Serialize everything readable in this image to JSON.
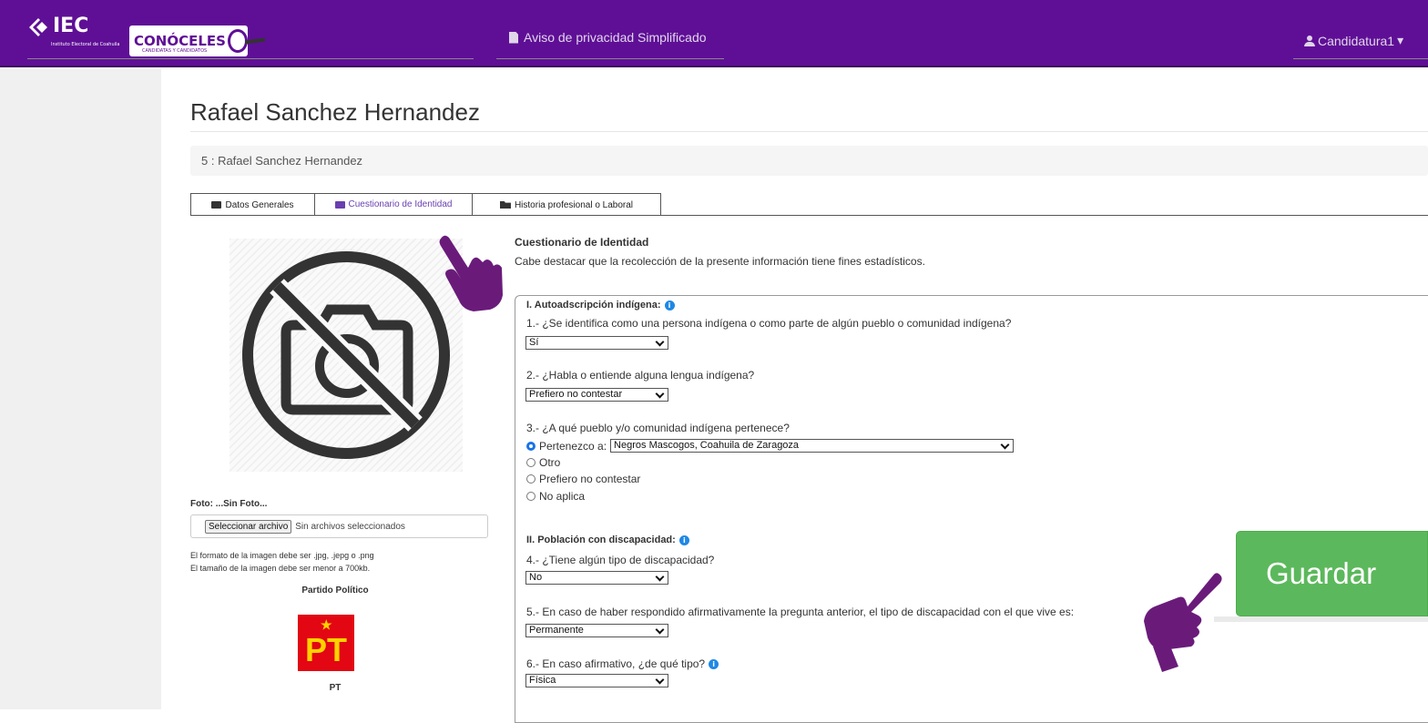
{
  "header": {
    "logo_iec": "IEC",
    "logo_iec_sub": "Instituto Electoral de Coahuila",
    "logo_conoceles": "CONÓCELES",
    "logo_conoceles_sub": "CANDIDATAS Y CANDIDATOS",
    "privacy_link": "Aviso de privacidad Simplificado",
    "user_menu": "Candidatura1",
    "colors": {
      "bar": "#5f0f96",
      "text": "#e0d6ea"
    }
  },
  "page": {
    "title": "Rafael Sanchez Hernandez",
    "breadcrumb": "5 : Rafael Sanchez Hernandez"
  },
  "tabs": [
    {
      "label": "Datos Generales",
      "icon": "id-card-icon",
      "active": false
    },
    {
      "label": "Cuestionario de Identidad",
      "icon": "id-card-icon",
      "active": true
    },
    {
      "label": "Historia profesional o Laboral",
      "icon": "folder-open-icon",
      "active": false
    }
  ],
  "left": {
    "photo_icon": "no-camera-icon",
    "foto_label": "Foto: ...Sin Foto...",
    "file_button": "Seleccionar archivo",
    "file_status": "Sin archivos seleccionados",
    "hint1": "El formato de la imagen debe ser .jpg, .jepg o .png",
    "hint2": "El tamaño de la imagen debe ser menor a 700kb.",
    "partido_label": "Partido Político",
    "partido_logo": "PT",
    "partido_name": "PT"
  },
  "questionnaire": {
    "title": "Cuestionario de Identidad",
    "description": "Cabe destacar que la recolección de la presente información tiene fines estadísticos.",
    "section1": "I. Autoadscripción indígena:",
    "q1": "1.- ¿Se identifica como una persona indígena o como parte de algún pueblo o comunidad indígena?",
    "q1_value": "Sí",
    "q2": "2.- ¿Habla o entiende alguna lengua indígena?",
    "q2_value": "Prefiero no contestar",
    "q3": "3.- ¿A qué pueblo y/o comunidad indígena pertenece?",
    "q3_opt1": "Pertenezco a:",
    "q3_opt1_value": "Negros Mascogos, Coahuila de Zaragoza",
    "q3_opt2": "Otro",
    "q3_opt3": "Prefiero no contestar",
    "q3_opt4": "No aplica",
    "section2": "II. Población con discapacidad:",
    "q4": "4.- ¿Tiene algún tipo de discapacidad?",
    "q4_value": "No",
    "q5": "5.- En caso de haber respondido afirmativamente la pregunta anterior, el tipo de discapacidad con el que vive es:",
    "q5_value": "Permanente",
    "q6": "6.- En caso afirmativo, ¿de qué tipo?",
    "q6_value": "Física"
  },
  "actions": {
    "save": "Guardar",
    "save_color": "#5cb85c",
    "pointer_color": "#6a1b7a"
  }
}
